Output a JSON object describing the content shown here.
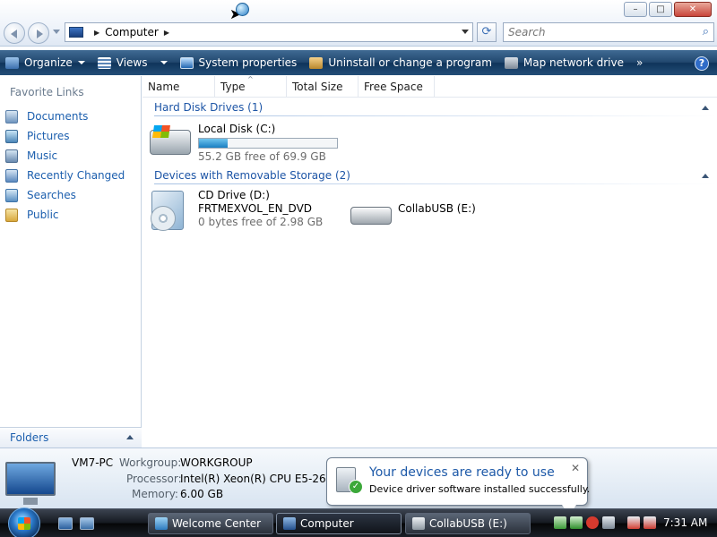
{
  "window": {
    "minimize": "–",
    "maximize": "□",
    "close": "✕"
  },
  "address": {
    "location": "Computer",
    "search_placeholder": "Search"
  },
  "toolbar": {
    "organize": "Organize",
    "views": "Views",
    "system_properties": "System properties",
    "uninstall": "Uninstall or change a program",
    "map_drive": "Map network drive",
    "more": "»",
    "help": "?"
  },
  "sidebar": {
    "title": "Favorite Links",
    "items": [
      {
        "label": "Documents",
        "icon": "documents-icon"
      },
      {
        "label": "Pictures",
        "icon": "pictures-icon"
      },
      {
        "label": "Music",
        "icon": "music-icon"
      },
      {
        "label": "Recently Changed",
        "icon": "recently-changed-icon"
      },
      {
        "label": "Searches",
        "icon": "searches-icon"
      },
      {
        "label": "Public",
        "icon": "public-folder-icon"
      }
    ],
    "folders": "Folders"
  },
  "columns": [
    "Name",
    "Type",
    "Total Size",
    "Free Space"
  ],
  "groups": {
    "hard_disks": "Hard Disk Drives (1)",
    "removable": "Devices with Removable Storage (2)"
  },
  "drives": {
    "local": {
      "name": "Local Disk (C:)",
      "free": "55.2 GB free of 69.9 GB",
      "used_fraction": 0.21
    },
    "cd": {
      "name": "CD Drive (D:)",
      "label": "FRTMEXVOL_EN_DVD",
      "free": "0 bytes free of 2.98 GB"
    },
    "usb": {
      "name": "CollabUSB (E:)"
    }
  },
  "details": {
    "pc_name": "VM7-PC",
    "workgroup_label": "Workgroup:",
    "workgroup": "WORKGROUP",
    "processor_label": "Processor:",
    "processor": "Intel(R) Xeon(R) CPU E5-2697 v",
    "memory_label": "Memory:",
    "memory": "6.00 GB"
  },
  "balloon": {
    "title": "Your devices are ready to use",
    "text": "Device driver software installed successfully."
  },
  "taskbar": {
    "tasks": [
      "Welcome Center",
      "Computer",
      "CollabUSB (E:)"
    ],
    "time": "7:31 AM"
  },
  "colors": {
    "link_blue": "#1c5fae",
    "command_bar": "#22486f",
    "taskbar": "#14181f"
  }
}
